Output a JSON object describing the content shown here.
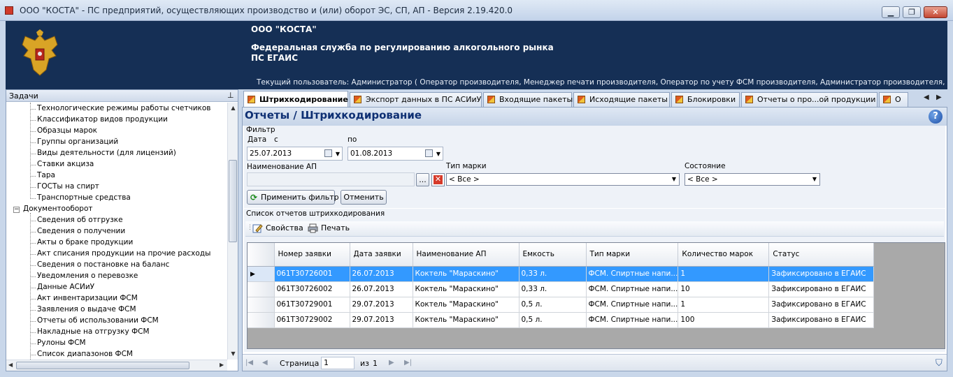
{
  "window": {
    "title": "ООО \"КОСТА\" - ПС предприятий, осуществляющих производство и (или) оборот ЭС, СП, АП - Версия 2.19.420.0"
  },
  "banner": {
    "org": "ООО \"КОСТА\"",
    "service_line1": "Федеральная служба по регулированию алкогольного рынка",
    "service_line2": "ПС ЕГАИС",
    "user": "Текущий пользователь: Администратор ( Оператор производителя, Менеджер печати производителя, Оператор по учету ФСМ производителя, Администратор производителя, Оператор печа..."
  },
  "left_panel": {
    "title": "Задачи",
    "items_top": [
      "Технологические режимы работы счетчиков",
      "Классификатор видов продукции",
      "Образцы марок",
      "Группы организаций",
      "Виды деятельности (для лицензий)",
      "Ставки акциза",
      "Тара",
      "ГОСТы на спирт",
      "Транспортные средства"
    ],
    "group": "Документооборот",
    "items_group": [
      "Сведения об отгрузке",
      "Сведения о получении",
      "Акты о браке продукции",
      "Акт списания продукции на прочие расходы",
      "Сведения о постановке на баланс",
      "Уведомления о перевозке",
      "Данные АСИиУ",
      "Акт инвентаризации ФСМ",
      "Заявления о выдаче ФСМ",
      "Отчеты об использовании ФСМ",
      "Накладные на отгрузку ФСМ",
      "Рулоны ФСМ",
      "Список диапазонов ФСМ"
    ]
  },
  "tabs": [
    "Штрихкодирование",
    "Экспорт данных в ПС АСИиУ",
    "Входящие пакеты",
    "Исходящие пакеты",
    "Блокировки",
    "Отчеты о про...ой продукции",
    "О"
  ],
  "page": {
    "title": "Отчеты / Штрихкодирование",
    "help": "?"
  },
  "filter": {
    "title": "Фильтр",
    "date_label": "Дата",
    "from_label": "с",
    "to_label": "по",
    "date_from": "25.07.2013",
    "date_to": "01.08.2013",
    "name_label": "Наименование АП",
    "name_value": "",
    "browse": "...",
    "mark_type_label": "Тип марки",
    "mark_type_value": "< Все >",
    "state_label": "Состояние",
    "state_value": "< Все >",
    "apply": "Применить фильтр",
    "cancel": "Отменить"
  },
  "list": {
    "title": "Список отчетов штрихкодирования",
    "properties": "Свойства",
    "print": "Печать",
    "columns": [
      "Номер заявки",
      "Дата заявки",
      "Наименование АП",
      "Емкость",
      "Тип марки",
      "Количество марок",
      "Статус"
    ],
    "rows": [
      [
        "061T30726001",
        "26.07.2013",
        "Коктель \"Мараскино\"",
        "0,33 л.",
        "ФСМ. Спиртные напи...",
        "1",
        "Зафиксировано в ЕГАИС"
      ],
      [
        "061T30726002",
        "26.07.2013",
        "Коктель \"Мараскино\"",
        "0,33 л.",
        "ФСМ. Спиртные напи...",
        "10",
        "Зафиксировано в ЕГАИС"
      ],
      [
        "061T30729001",
        "29.07.2013",
        "Коктель \"Мараскино\"",
        "0,5 л.",
        "ФСМ. Спиртные напи...",
        "1",
        "Зафиксировано в ЕГАИС"
      ],
      [
        "061T30729002",
        "29.07.2013",
        "Коктель \"Мараскино\"",
        "0,5 л.",
        "ФСМ. Спиртные напи...",
        "100",
        "Зафиксировано в ЕГАИС"
      ]
    ],
    "selected_row": 0
  },
  "pager": {
    "page_label": "Страница",
    "page_value": "1",
    "of_label": "из",
    "of_value": "1"
  }
}
